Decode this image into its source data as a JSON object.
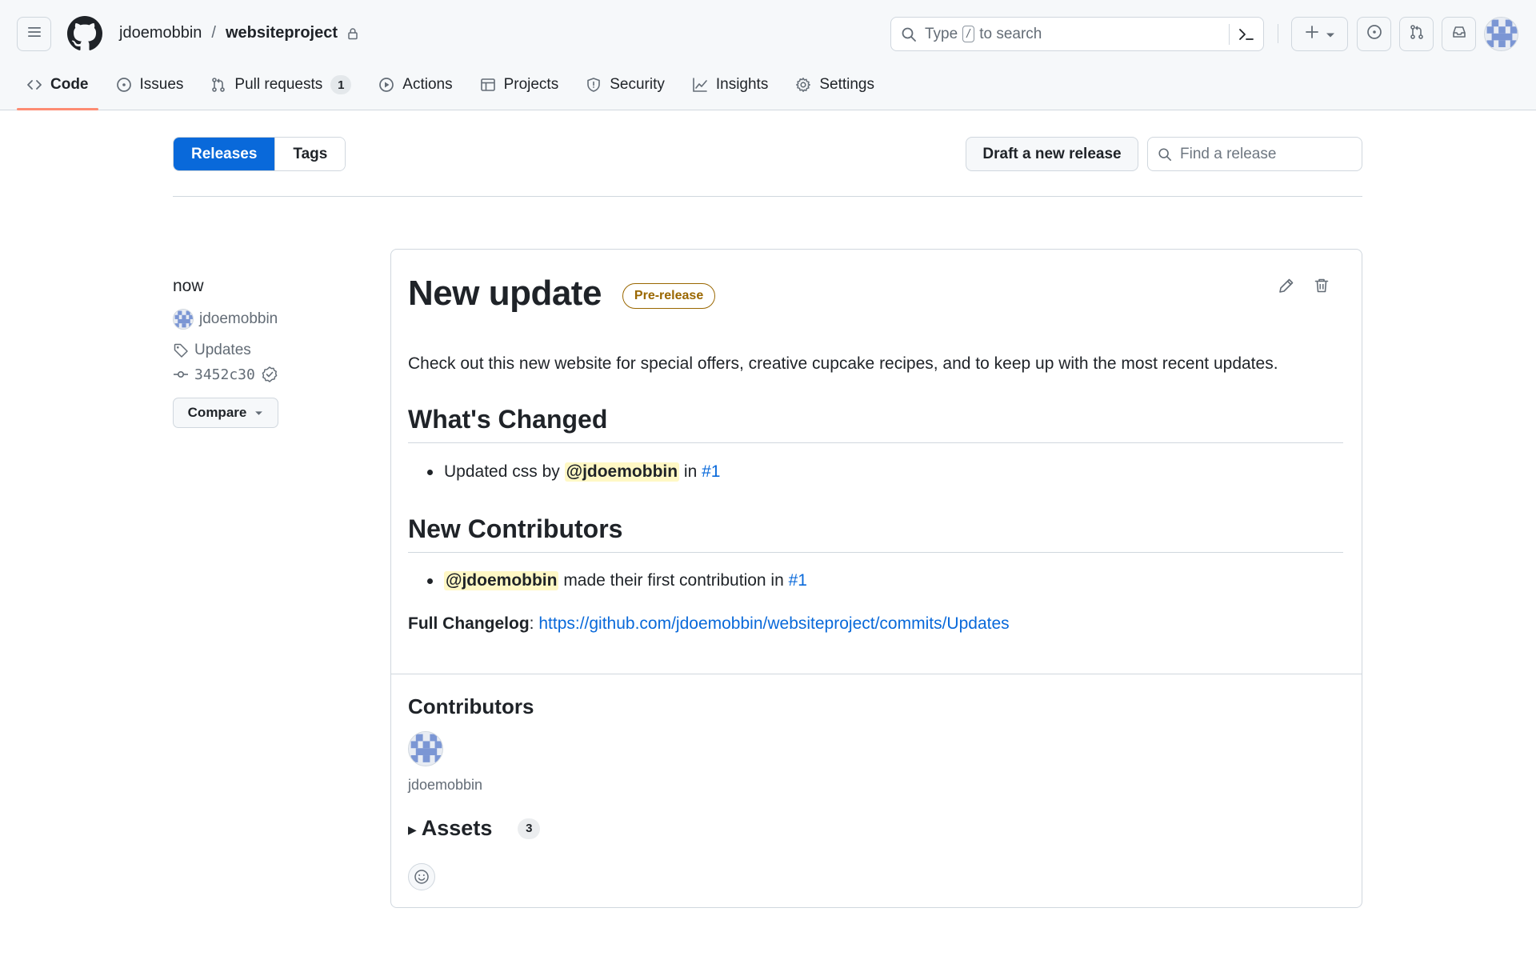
{
  "header": {
    "owner": "jdoemobbin",
    "separator": "/",
    "repo": "websiteproject",
    "search": {
      "prefix": "Type",
      "key": "/",
      "suffix": "to search"
    }
  },
  "nav": {
    "items": [
      {
        "label": "Code",
        "icon": "code-icon",
        "active": true
      },
      {
        "label": "Issues",
        "icon": "issue-icon"
      },
      {
        "label": "Pull requests",
        "icon": "pull-request-icon",
        "count": "1"
      },
      {
        "label": "Actions",
        "icon": "play-icon"
      },
      {
        "label": "Projects",
        "icon": "table-icon"
      },
      {
        "label": "Security",
        "icon": "shield-icon"
      },
      {
        "label": "Insights",
        "icon": "graph-icon"
      },
      {
        "label": "Settings",
        "icon": "gear-icon"
      }
    ]
  },
  "subnav": {
    "releases_label": "Releases",
    "tags_label": "Tags",
    "draft_label": "Draft a new release",
    "find_placeholder": "Find a release"
  },
  "release": {
    "time": "now",
    "author": "jdoemobbin",
    "tag": "Updates",
    "sha": "3452c30",
    "compare_label": "Compare",
    "title": "New update",
    "badge": "Pre-release",
    "description": "Check out this new website for special offers, creative cupcake recipes, and to keep up with the most recent updates.",
    "whats_changed_heading": "What's Changed",
    "change_item": {
      "text": "Updated css by",
      "mention": "@jdoemobbin",
      "in": "in",
      "pr": "#1"
    },
    "new_contributors_heading": "New Contributors",
    "contributor_item": {
      "mention": "@jdoemobbin",
      "text": "made their first contribution in",
      "pr": "#1"
    },
    "changelog": {
      "label": "Full Changelog",
      "colon": ":",
      "url": "https://github.com/jdoemobbin/websiteproject/commits/Updates"
    },
    "contributors_heading": "Contributors",
    "contributor_name": "jdoemobbin",
    "assets_label": "Assets",
    "assets_count": "3"
  },
  "colors": {
    "accent": "#0969da",
    "nav_underline": "#fd8c73",
    "prerelease": "#9a6700",
    "mention_bg": "#fff8c5"
  }
}
